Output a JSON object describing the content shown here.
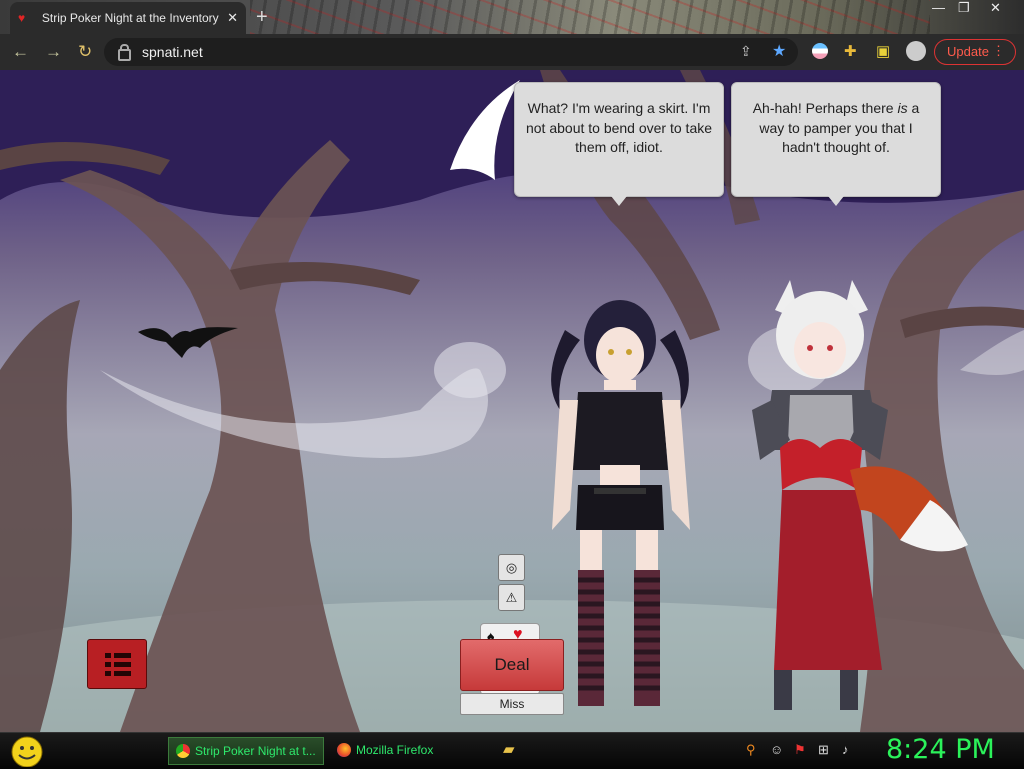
{
  "browser": {
    "tab_title": "Strip Poker Night at the Inventory",
    "tab_close": "✕",
    "new_tab": "+",
    "url": "spnati.net",
    "update_label": "Update",
    "window_controls": [
      "—",
      "❐",
      "✕"
    ]
  },
  "game": {
    "bubble_left": "What? I'm wearing a skirt. I'm not about to bend over to take them off, idiot.",
    "bubble_right_before": "Ah-hah! Perhaps there ",
    "bubble_right_emph": "is",
    "bubble_right_after": " a way to pamper you that I hadn't thought of.",
    "deal_label": "Deal",
    "miss_label": "Miss",
    "hide_icon": "eye-slash-icon",
    "warning_icon": "warning-icon",
    "menu_icon": "list-icon"
  },
  "taskbar": {
    "tasks": [
      {
        "label": "Strip Poker Night at t...",
        "icon": "chrome-icon"
      },
      {
        "label": "Mozilla Firefox",
        "icon": "firefox-icon"
      }
    ],
    "clock": "8:24 PM"
  },
  "colors": {
    "accent_red": "#b81f23",
    "deal_red": "#d04a4a",
    "clock_green": "#2bf25a",
    "update_red": "#ff5b4d"
  }
}
